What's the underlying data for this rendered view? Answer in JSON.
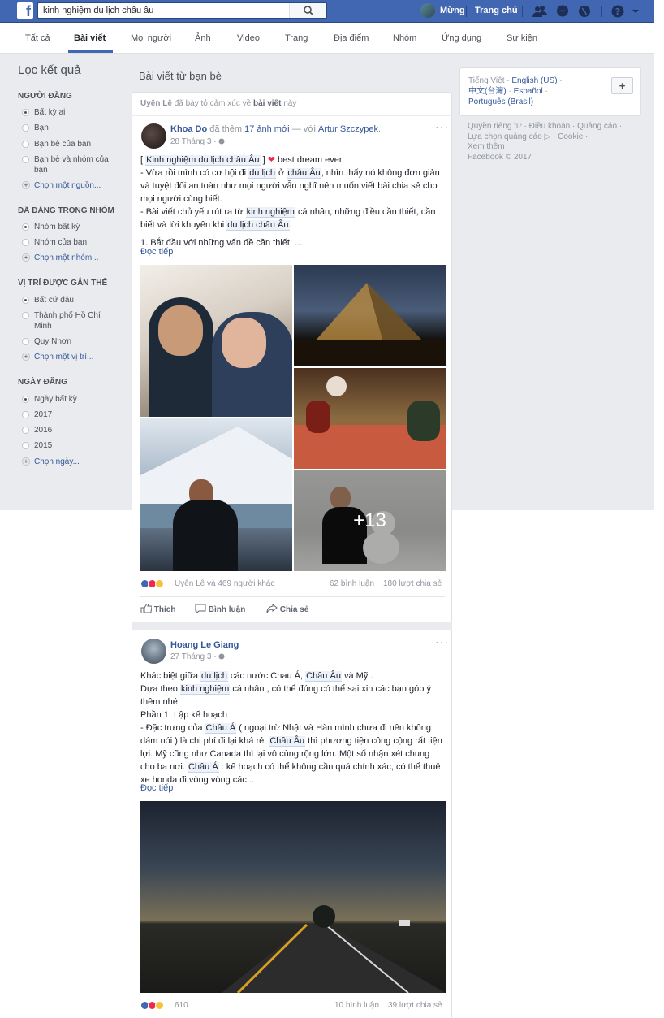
{
  "header": {
    "search_value": "kinh nghiệm du lịch châu âu",
    "user_name": "Mừng",
    "home_label": "Trang chủ"
  },
  "tabs": [
    "Tất cả",
    "Bài viết",
    "Mọi người",
    "Ảnh",
    "Video",
    "Trang",
    "Địa điểm",
    "Nhóm",
    "Ứng dụng",
    "Sự kiện"
  ],
  "active_tab": "Bài viết",
  "sidebar": {
    "title": "Lọc kết quả",
    "sections": [
      {
        "title": "NGƯỜI ĐĂNG",
        "options": [
          "Bất kỳ ai",
          "Bạn",
          "Bạn bè của bạn",
          "Bạn bè và nhóm của bạn"
        ],
        "link": "Chọn một nguồn..."
      },
      {
        "title": "ĐÃ ĐĂNG TRONG NHÓM",
        "options": [
          "Nhóm bất kỳ",
          "Nhóm của bạn"
        ],
        "link": "Chọn một nhóm..."
      },
      {
        "title": "VỊ TRÍ ĐƯỢC GẮN THẺ",
        "options": [
          "Bất cứ đâu",
          "Thành phố Hồ Chí Minh",
          "Quy Nhơn"
        ],
        "link": "Chọn một vị trí..."
      },
      {
        "title": "NGÀY ĐĂNG",
        "options": [
          "Ngày bất kỳ",
          "2017",
          "2016",
          "2015"
        ],
        "link": "Chọn ngày..."
      }
    ]
  },
  "main": {
    "title": "Bài viết từ bạn bè",
    "activity": {
      "actor": "Uyên Lê",
      "middle": "đã bày tỏ cảm xúc về",
      "object": "bài viết",
      "tail": "này"
    },
    "post1": {
      "author": "Khoa Do",
      "action": "đã thêm",
      "photos_link": "17 ảnh mới",
      "with": "— với",
      "tagged": "Artur Szczypek",
      "date": "28 Tháng 3 ·",
      "line1_tail": "best dream ever.",
      "read_more": "Đọc tiếp",
      "more_photos": "+13",
      "reactions": "Uyên Lê và 469 người khác",
      "comments": "62 bình luận",
      "shares": "180 lượt chia sẻ"
    },
    "actions": {
      "like": "Thích",
      "comment": "Bình luận",
      "share": "Chia sẻ"
    },
    "post2": {
      "author": "Hoang Le Giang",
      "date": "27 Tháng 3 ·",
      "read_more": "Đọc tiếp",
      "reactions": "610",
      "comments": "10 bình luận",
      "shares": "39 lượt chia sẻ"
    }
  },
  "right": {
    "languages": [
      "Tiếng Việt",
      "English (US)",
      "中文(台灣)",
      "Español",
      "Português (Brasil)"
    ],
    "footer": [
      "Quyền riêng tư",
      "Điều khoản",
      "Quảng cáo",
      "Lựa chọn quảng cáo",
      "Cookie",
      "Xem thêm",
      "Facebook © 2017"
    ]
  },
  "colors": {
    "brand": "#4267b2",
    "link": "#365899",
    "background": "#e9ebee"
  }
}
